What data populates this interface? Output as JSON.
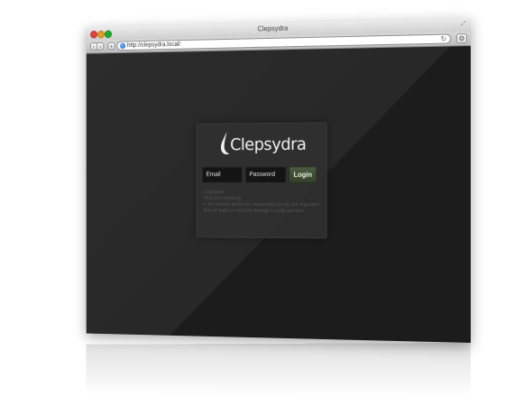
{
  "window": {
    "title": "Clepsydra",
    "url": "http://clepsydra.local/"
  },
  "icons": {
    "back": "chevron-left-icon",
    "forward": "chevron-right-icon",
    "add": "plus-icon",
    "globe": "globe-icon",
    "reload": "reload-icon",
    "settings": "gear-icon",
    "fullscreen": "fullscreen-icon"
  },
  "login": {
    "logo_text": "Clepsydra",
    "email_placeholder": "Email",
    "password_placeholder": "Password",
    "login_label": "Login",
    "info_lines": [
      "Clepsydra",
      "Fluid time tracking.",
      "n. An ancient device for measuring time by the regulated flow of water or mercury through a small aperture."
    ]
  },
  "colors": {
    "background": "#1c1c1c",
    "panel": "#303030",
    "button": "#3f4d35"
  }
}
